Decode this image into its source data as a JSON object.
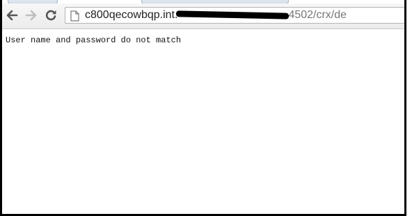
{
  "browser": {
    "address_bar": {
      "url_host_start": "c800qecowbqp.int.",
      "url_host_end": "4502",
      "url_path": "/crx/de"
    },
    "icons": {
      "back": "back-arrow-icon",
      "forward": "forward-arrow-icon",
      "reload": "reload-icon",
      "page": "page-icon"
    }
  },
  "page": {
    "message": "User name and password do not match"
  }
}
